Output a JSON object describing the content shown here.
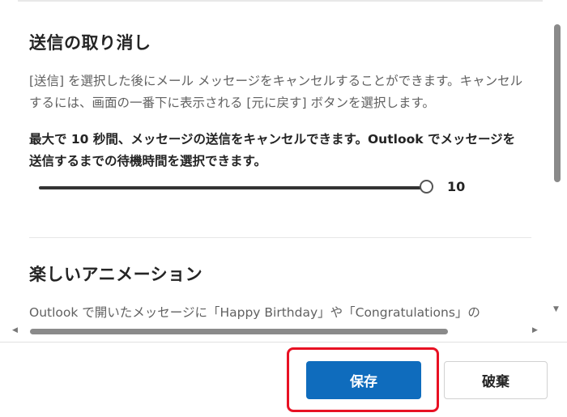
{
  "undo_send": {
    "title": "送信の取り消し",
    "description": "[送信] を選択した後にメール メッセージをキャンセルすることができます。キャンセルするには、画面の一番下に表示される [元に戻す] ボタンを選択します。",
    "note": "最大で 10 秒間、メッセージの送信をキャンセルできます。Outlook でメッセージを送信するまでの待機時間を選択できます。",
    "slider_value": "10",
    "slider_fraction": 1.0
  },
  "animations": {
    "title": "楽しいアニメーション",
    "description": "Outlook で開いたメッセージに「Happy Birthday」や「Congratulations」の"
  },
  "footer": {
    "save_label": "保存",
    "discard_label": "破棄"
  },
  "icons": {
    "scroll_down": "chevron-down-icon",
    "scroll_left": "chevron-left-icon",
    "scroll_right": "chevron-right-icon"
  },
  "colors": {
    "primary": "#0f6cbd",
    "highlight": "#e81123"
  }
}
